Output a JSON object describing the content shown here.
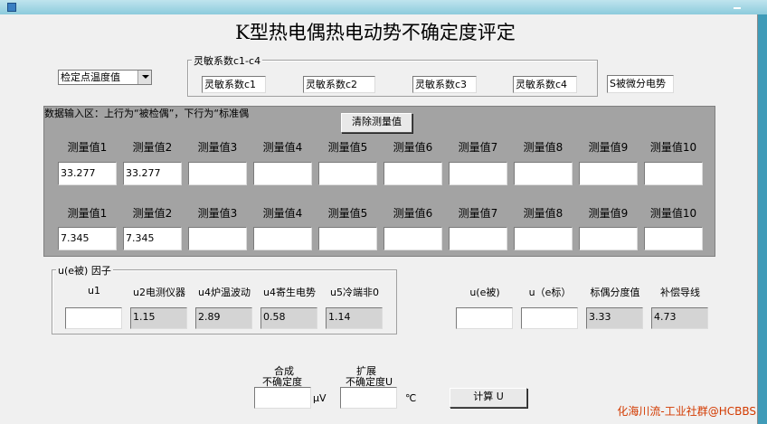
{
  "title": "K型热电偶热电动势不确定度评定",
  "temp_select": {
    "value": "检定点温度值"
  },
  "sensitivity": {
    "group_label": "灵敏系数c1-c4",
    "fields": [
      "灵敏系数c1",
      "灵敏系数c2",
      "灵敏系数c3",
      "灵敏系数c4"
    ],
    "s_field": "S被微分电势"
  },
  "data_input": {
    "label": "数据输入区：上行为“被检偶”，下行为“标准偶",
    "clear_button": "清除测量值",
    "upper_headers": [
      "测量值1",
      "测量值2",
      "测量值3",
      "测量值4",
      "测量值5",
      "测量值6",
      "测量值7",
      "测量值8",
      "测量值9",
      "测量值10"
    ],
    "upper_values": [
      "33.277",
      "33.277",
      "",
      "",
      "",
      "",
      "",
      "",
      "",
      ""
    ],
    "lower_headers": [
      "测量值1",
      "测量值2",
      "测量值3",
      "测量值4",
      "测量值5",
      "测量值6",
      "测量值7",
      "测量值8",
      "测量值9",
      "测量值10"
    ],
    "lower_values": [
      "7.345",
      "7.345",
      "",
      "",
      "",
      "",
      "",
      "",
      "",
      ""
    ]
  },
  "factors": {
    "group_label": "u(e被) 因子",
    "labels": [
      "u1",
      "u2电测仪器",
      "u4炉温波动",
      "u4寄生电势",
      "u5冷端非0"
    ],
    "values": [
      "",
      "1.15",
      "2.89",
      "0.58",
      "1.14"
    ]
  },
  "right_group": {
    "labels": [
      "u(e被)",
      "u（e标）",
      "标偶分度值",
      "补偿导线"
    ],
    "values": [
      "",
      "",
      "3.33",
      "4.73"
    ]
  },
  "combined": {
    "label_line1": "合成",
    "label_line2": "不确定度",
    "unit": "μV",
    "value": ""
  },
  "expanded": {
    "label_line1": "扩展",
    "label_line2": "不确定度U",
    "unit": "℃",
    "value": ""
  },
  "calc_button": "计算 U",
  "watermark": "化海川流-工业社群@HCBBS"
}
